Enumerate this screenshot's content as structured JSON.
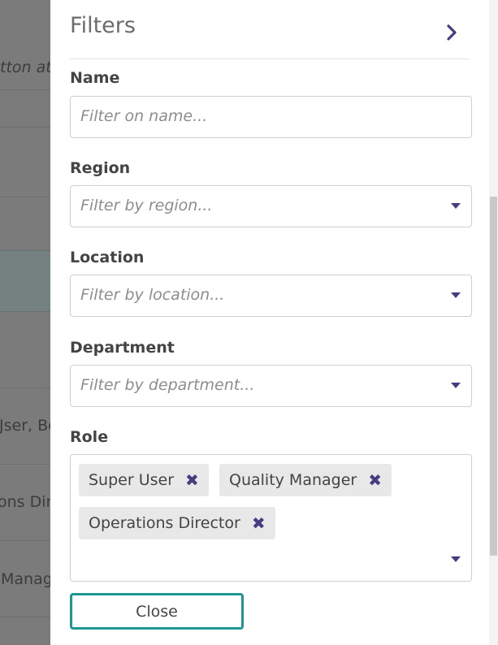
{
  "backdrop": {
    "texts": [
      "tton at",
      "Jser, Be",
      "ons Dir",
      "Manag"
    ]
  },
  "panel": {
    "title": "Filters",
    "collapse_icon": "chevron-right-icon",
    "accent_color": "#463c82",
    "button_border_color": "#1c9794"
  },
  "filters": {
    "name": {
      "label": "Name",
      "placeholder": "Filter on name..."
    },
    "region": {
      "label": "Region",
      "placeholder": "Filter by region..."
    },
    "location": {
      "label": "Location",
      "placeholder": "Filter by location..."
    },
    "department": {
      "label": "Department",
      "placeholder": "Filter by department..."
    },
    "role": {
      "label": "Role",
      "selected": [
        "Super User",
        "Quality Manager",
        "Operations Director"
      ]
    }
  },
  "actions": {
    "close_label": "Close"
  }
}
